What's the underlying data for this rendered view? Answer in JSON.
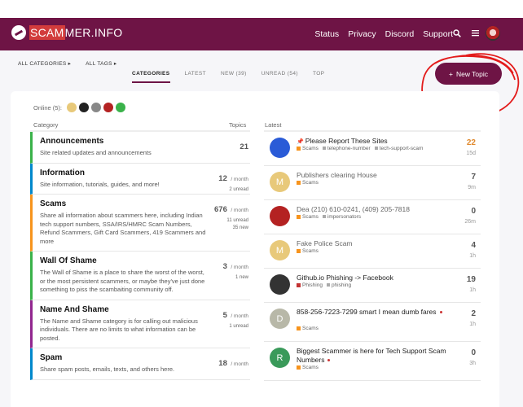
{
  "header": {
    "logo_prefix": "SCAM",
    "logo_suffix": "MER.INFO",
    "nav": [
      "Status",
      "Privacy",
      "Discord",
      "Support"
    ],
    "search_icon": "search-icon",
    "menu_icon": "hamburger-icon"
  },
  "filters": {
    "categories": "ALL CATEGORIES ▸",
    "tags": "ALL TAGS ▸"
  },
  "tabs": [
    "CATEGORIES",
    "LATEST",
    "NEW (39)",
    "UNREAD (54)",
    "TOP"
  ],
  "new_topic": {
    "icon": "+",
    "label": "New Topic"
  },
  "online": {
    "label": "Online (5):"
  },
  "columns": {
    "category": "Category",
    "topics": "Topics",
    "latest": "Latest"
  },
  "categories": [
    {
      "name": "Announcements",
      "desc": "Site related updates and announcements",
      "count": "21",
      "per": "",
      "unread": "",
      "unread2": "",
      "color": "#3ab24a"
    },
    {
      "name": "Information",
      "desc": "Site information, tutorials, guides, and more!",
      "count": "12",
      "per": "/ month",
      "unread": "2 unread",
      "unread2": "",
      "color": "#0088cc"
    },
    {
      "name": "Scams",
      "desc": "Share all information about scammers here, including Indian tech support numbers, SSA/IRS/HMRC Scam Numbers, Refund Scammers, Gift Card Scammers, 419 Scammers and more",
      "count": "676",
      "per": "/ month",
      "unread": "11 unread",
      "unread2": "35 new",
      "color": "#f7941d"
    },
    {
      "name": "Wall Of Shame",
      "desc": "The Wall of Shame is a place to share the worst of the worst, or the most persistent scammers, or maybe they've just done something to piss the scambaiting community off.",
      "count": "3",
      "per": "/ month",
      "unread": "1 new",
      "unread2": "",
      "color": "#3ab24a"
    },
    {
      "name": "Name And Shame",
      "desc": "The Name and Shame category is for calling out malicious individuals. There are no limits to what information can be posted.",
      "count": "5",
      "per": "/ month",
      "unread": "1 unread",
      "unread2": "",
      "color": "#92278f"
    },
    {
      "name": "Spam",
      "desc": "Share spam posts, emails, texts, and others here.",
      "count": "18",
      "per": "/ month",
      "unread": "",
      "unread2": "",
      "color": "#0088cc"
    }
  ],
  "topics": [
    {
      "title": "Please Report These Sites",
      "pinned": "📌",
      "cat": "Scams",
      "tags": [
        "telephone-number",
        "tech-support-scam"
      ],
      "count": "22",
      "age": "15d",
      "hot": true,
      "visited": false,
      "avatar_letter": "",
      "avatar_color": "#2a5bd7"
    },
    {
      "title": "Publishers clearing House",
      "pinned": "",
      "cat": "Scams",
      "tags": [],
      "count": "7",
      "age": "9m",
      "hot": false,
      "visited": true,
      "avatar_letter": "M",
      "avatar_color": "#e8c97a"
    },
    {
      "title": "Dea (210) 610-0241, (409) 205-7818",
      "pinned": "",
      "cat": "Scams",
      "tags": [
        "impersonators"
      ],
      "count": "0",
      "age": "26m",
      "hot": false,
      "visited": true,
      "avatar_letter": "",
      "avatar_color": "#b42222"
    },
    {
      "title": "Fake Police Scam",
      "pinned": "",
      "cat": "Scams",
      "tags": [],
      "count": "4",
      "age": "1h",
      "hot": false,
      "visited": true,
      "avatar_letter": "M",
      "avatar_color": "#e8c97a"
    },
    {
      "title": "Github.io Phishing -> Facebook",
      "pinned": "",
      "cat": "Phishing",
      "tags": [
        "phishing"
      ],
      "count": "19",
      "age": "1h",
      "hot": false,
      "visited": false,
      "avatar_letter": "",
      "avatar_color": "#333333"
    },
    {
      "title": "858-256-7223-7299 smart I mean dumb fares",
      "pinned": "",
      "cat": "Scams",
      "tags": [],
      "count": "2",
      "age": "1h",
      "hot": false,
      "visited": false,
      "avatar_letter": "D",
      "avatar_color": "#b8b8a8"
    },
    {
      "title": "Biggest Scammer is here for Tech Support Scam Numbers",
      "pinned": "",
      "cat": "Scams",
      "tags": [],
      "count": "0",
      "age": "3h",
      "hot": false,
      "visited": false,
      "avatar_letter": "R",
      "avatar_color": "#3a9a5a"
    }
  ],
  "colors": {
    "brand": "#6e1445",
    "scams": "#f7941d",
    "phishing": "#c33333"
  }
}
